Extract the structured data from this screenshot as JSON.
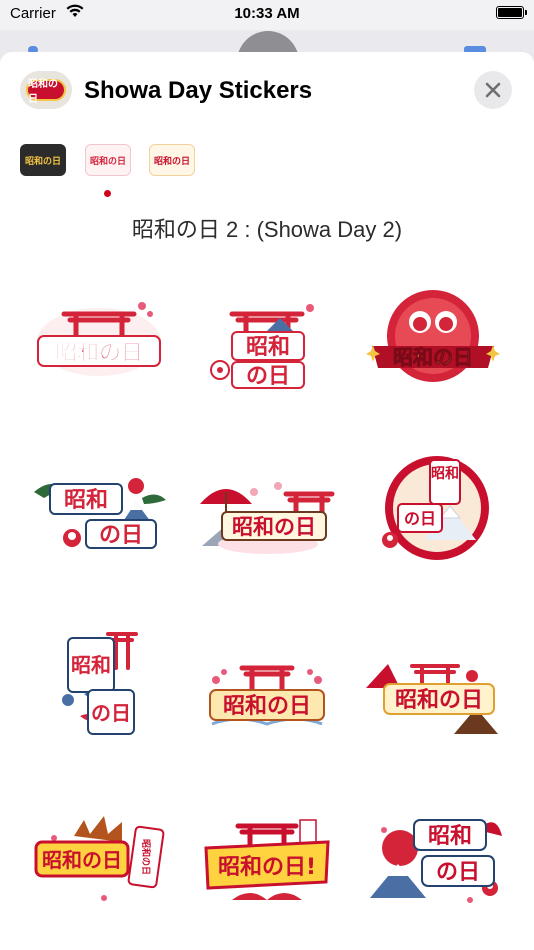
{
  "status": {
    "carrier": "Carrier",
    "time": "10:33 AM"
  },
  "header": {
    "title": "Showa Day Stickers",
    "app_icon_text": "昭和の日",
    "close_icon": "close-icon"
  },
  "packs": [
    {
      "label": "昭和の日"
    },
    {
      "label": "昭和の日"
    },
    {
      "label": "昭和の日"
    }
  ],
  "pack_title": "昭和の日 2 : (Showa Day 2)",
  "colors": {
    "accent_red": "#d3243a",
    "gold": "#f4c542",
    "dot": "#d0021b"
  },
  "stickers": [
    {
      "text1": "昭和の日",
      "text2": "",
      "style": "torii-white"
    },
    {
      "text1": "昭和",
      "text2": "の日",
      "style": "fuji-stacked"
    },
    {
      "text1": "昭和の日",
      "text2": "",
      "style": "red-badge"
    },
    {
      "text1": "昭和",
      "text2": "の日",
      "style": "pine-fuji"
    },
    {
      "text1": "昭和の日",
      "text2": "",
      "style": "umbrella-torii"
    },
    {
      "text1": "昭和",
      "text2": "の日",
      "style": "circle-badge"
    },
    {
      "text1": "昭和",
      "text2": "の日",
      "style": "vertical-koi"
    },
    {
      "text1": "昭和の日",
      "text2": "",
      "style": "torii-orange"
    },
    {
      "text1": "昭和の日",
      "text2": "",
      "style": "fan-gold"
    },
    {
      "text1": "昭和の日",
      "text2": "昭和の日",
      "style": "burst-yellow"
    },
    {
      "text1": "昭和の日!",
      "text2": "",
      "style": "wave-yellow"
    },
    {
      "text1": "昭和",
      "text2": "の日",
      "style": "fuji-pink"
    }
  ]
}
